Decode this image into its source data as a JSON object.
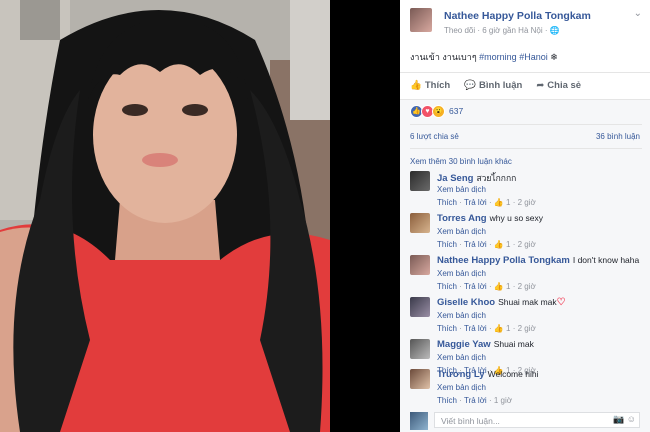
{
  "post": {
    "author": "Nathee Happy Polla Tongkam",
    "meta": "Theo dõi · 6 giờ gần Hà Nội · ",
    "caption_prefix": "งานเข้า งานเบาๆ ",
    "caption_tags": [
      "#morning",
      "#Hanoi"
    ],
    "caption_suffix": " ❄"
  },
  "actions": {
    "like": "Thích",
    "comment": "Bình luận",
    "share": "Chia sẻ"
  },
  "reactions": {
    "count": "637",
    "colors": {
      "like": "#4267b2",
      "love": "#f25268",
      "wow": "#f7b125"
    }
  },
  "stats": {
    "shares": "6 lượt chia sẻ",
    "comments": "36 bình luận"
  },
  "view_more": "Xem thêm 30 bình luận khác",
  "labels": {
    "translate": "Xem bản dịch",
    "like": "Thích",
    "reply": "Trả lời"
  },
  "comments": [
    {
      "name": "Ja Seng",
      "text": "สวยไ้กกกก",
      "likes": "1",
      "time": "2 giờ",
      "heart": false
    },
    {
      "name": "Torres Ang",
      "text": "why u so sexy",
      "likes": "1",
      "time": "2 giờ",
      "heart": false
    },
    {
      "name": "Nathee Happy Polla Tongkam",
      "text": "I don't know haha",
      "likes": "1",
      "time": "2 giờ",
      "heart": false
    },
    {
      "name": "Giselle Khoo",
      "text": "Shuai mak mak",
      "likes": "1",
      "time": "2 giờ",
      "heart": true
    },
    {
      "name": "Maggie Yaw",
      "text": "Shuai mak",
      "likes": "1",
      "time": "2 giờ",
      "heart": false
    },
    {
      "name": "Trương Ly",
      "text": "Welcome hihi",
      "likes": "",
      "time": "1 giờ",
      "heart": false
    }
  ],
  "write": {
    "placeholder": "Viết bình luận..."
  }
}
